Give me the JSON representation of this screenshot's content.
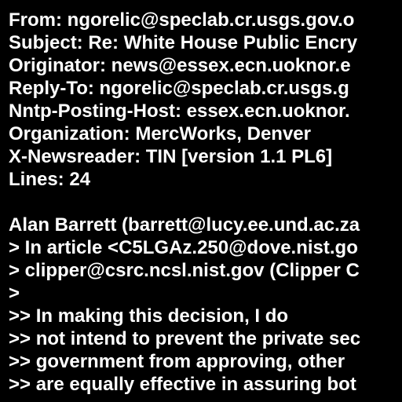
{
  "headers": [
    "From: ngorelic@speclab.cr.usgs.gov.o",
    "Subject: Re: White House Public Encry",
    "Originator: news@essex.ecn.uoknor.e",
    "Reply-To: ngorelic@speclab.cr.usgs.g",
    "Nntp-Posting-Host: essex.ecn.uoknor.",
    "Organization: MercWorks, Denver",
    "X-Newsreader: TIN [version 1.1 PL6]",
    "Lines: 24"
  ],
  "body": [
    "Alan Barrett (barrett@lucy.ee.und.ac.za",
    "> In article <C5LGAz.250@dove.nist.go",
    "> clipper@csrc.ncsl.nist.gov (Clipper C",
    ">",
    ">> In making this decision, I do",
    ">> not intend to prevent the private sec",
    ">> government from approving, other",
    ">> are equally effective in assuring bot"
  ]
}
